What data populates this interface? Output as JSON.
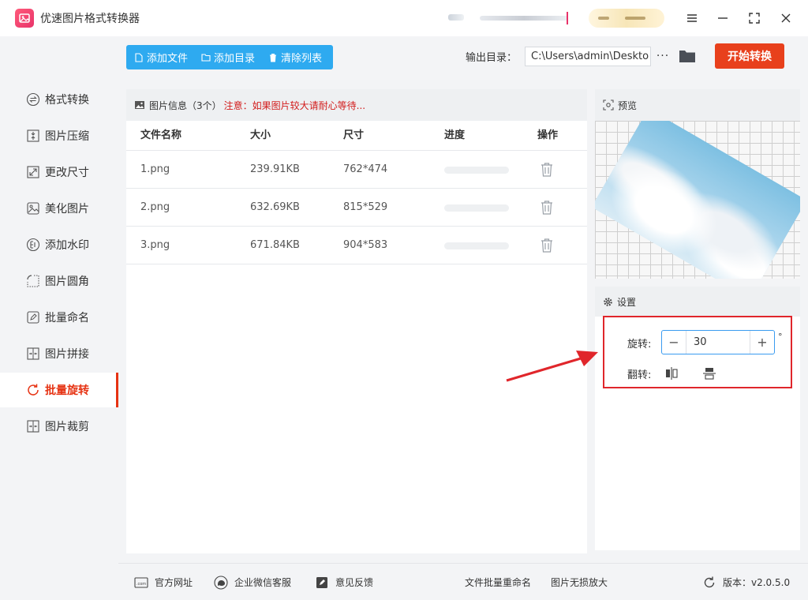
{
  "app": {
    "title": "优速图片格式转换器"
  },
  "sidebar": {
    "items": [
      {
        "label": "格式转换"
      },
      {
        "label": "图片压缩"
      },
      {
        "label": "更改尺寸"
      },
      {
        "label": "美化图片"
      },
      {
        "label": "添加水印"
      },
      {
        "label": "图片圆角"
      },
      {
        "label": "批量命名"
      },
      {
        "label": "图片拼接"
      },
      {
        "label": "批量旋转",
        "active": true
      },
      {
        "label": "图片裁剪"
      }
    ]
  },
  "toolbar": {
    "add_file": "添加文件",
    "add_dir": "添加目录",
    "clear_list": "清除列表",
    "output_label": "输出目录：",
    "output_path": "C:\\Users\\admin\\Deskto",
    "more": "···",
    "start": "开始转换"
  },
  "file_panel": {
    "title": "图片信息（3个）",
    "warning": "注意：如果图片较大请耐心等待...",
    "columns": {
      "name": "文件名称",
      "size": "大小",
      "dims": "尺寸",
      "progress": "进度",
      "action": "操作"
    },
    "rows": [
      {
        "name": "1.png",
        "size": "239.91KB",
        "dims": "762*474",
        "progress": 0
      },
      {
        "name": "2.png",
        "size": "632.69KB",
        "dims": "815*529",
        "progress": 0
      },
      {
        "name": "3.png",
        "size": "671.84KB",
        "dims": "904*583",
        "progress": 0
      }
    ]
  },
  "preview": {
    "title": "预览"
  },
  "settings": {
    "title": "设置",
    "rotate_label": "旋转:",
    "rotate_value": "30",
    "degree": "°",
    "flip_label": "翻转:"
  },
  "bottom": {
    "website": "官方网址",
    "wechat": "企业微信客服",
    "feedback": "意见反馈",
    "rename": "文件批量重命名",
    "upscale": "图片无损放大",
    "version": "版本：v2.0.5.0"
  },
  "colors": {
    "accent": "#e63212",
    "blue": "#2eaaf0",
    "start": "#e8401c",
    "highlight": "#e0262b"
  }
}
